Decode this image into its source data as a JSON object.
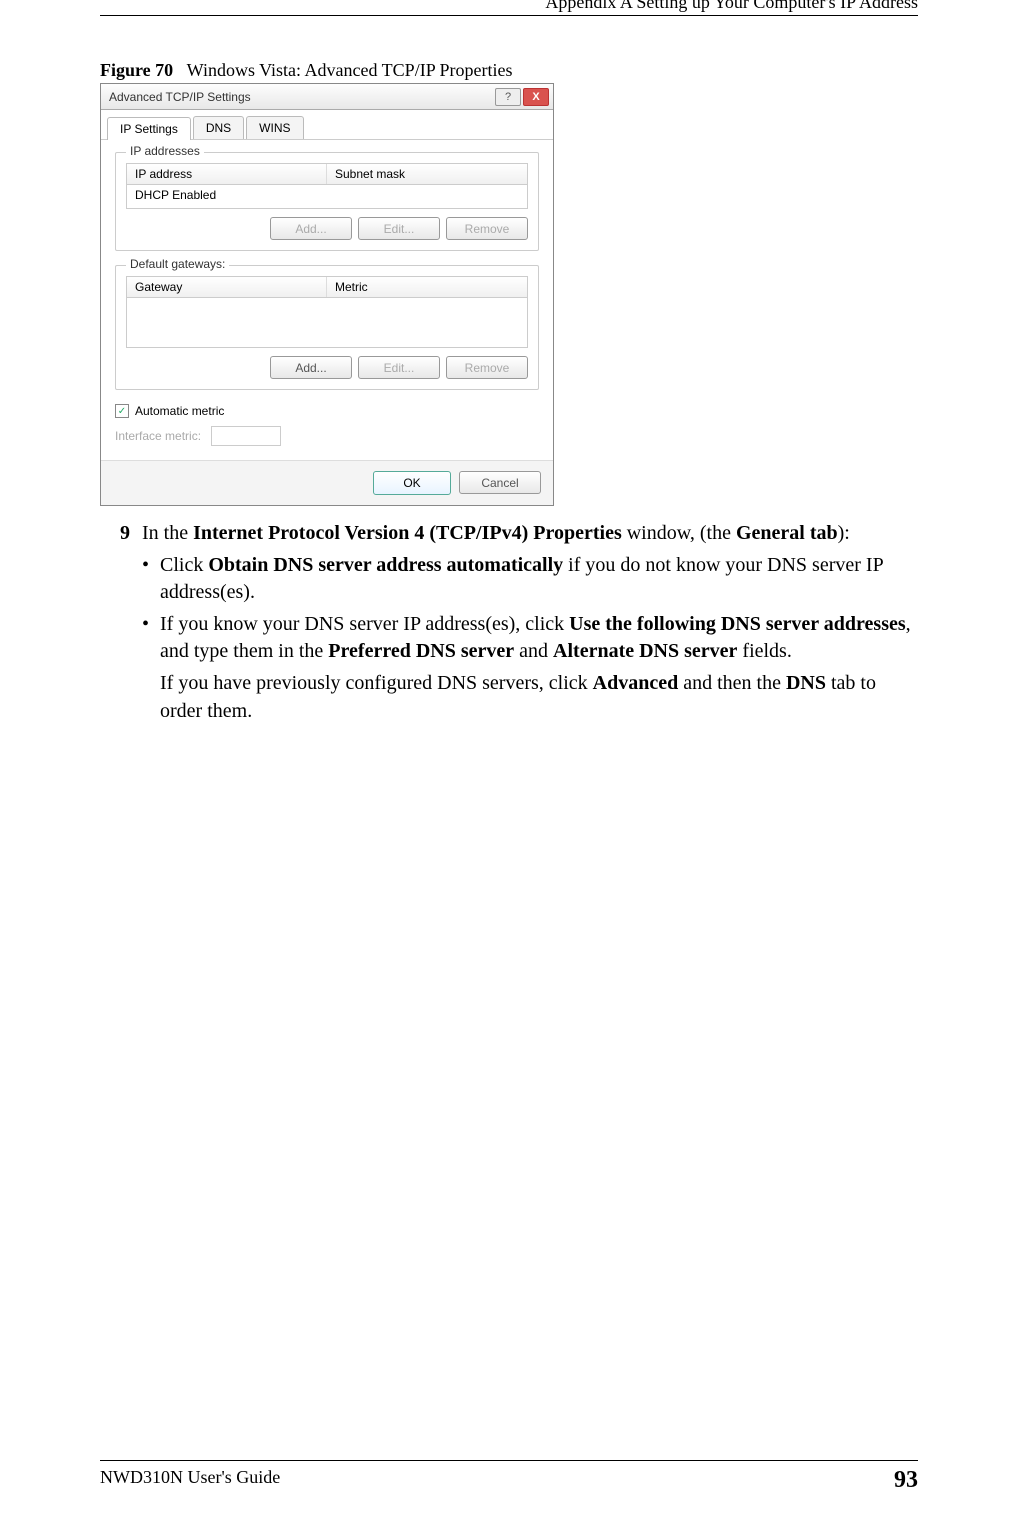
{
  "header": {
    "appendix": "Appendix A Setting up Your Computer's IP Address"
  },
  "figure": {
    "label": "Figure 70",
    "caption": "Windows Vista: Advanced TCP/IP Properties"
  },
  "dialog": {
    "title": "Advanced TCP/IP Settings",
    "help": "?",
    "close": "X",
    "tabs": {
      "ip": "IP Settings",
      "dns": "DNS",
      "wins": "WINS"
    },
    "group_ip": {
      "title": "IP addresses",
      "col_ip": "IP address",
      "col_subnet": "Subnet mask",
      "row_dhcp": "DHCP Enabled",
      "add": "Add...",
      "edit": "Edit...",
      "remove": "Remove"
    },
    "group_gw": {
      "title": "Default gateways:",
      "col_gw": "Gateway",
      "col_metric": "Metric",
      "add": "Add...",
      "edit": "Edit...",
      "remove": "Remove"
    },
    "auto_metric": "Automatic metric",
    "interface_metric": "Interface metric:",
    "ok": "OK",
    "cancel": "Cancel"
  },
  "step": {
    "num": "9",
    "intro_a": "In the ",
    "intro_b": "Internet Protocol Version 4 (TCP/IPv4) Properties",
    "intro_c": " window, (the ",
    "intro_d": "General tab",
    "intro_e": "):",
    "b1_a": "Click ",
    "b1_b": "Obtain DNS server address automatically",
    "b1_c": " if you do not know your DNS server IP address(es).",
    "b2_a": "If you know your DNS server IP address(es), click ",
    "b2_b": "Use the following DNS server addresses",
    "b2_c": ", and type them in the ",
    "b2_d": "Preferred DNS server",
    "b2_e": " and ",
    "b2_f": "Alternate DNS server",
    "b2_g": " fields.",
    "b3_a": "If you have previously configured DNS servers, click ",
    "b3_b": "Advanced",
    "b3_c": " and then the ",
    "b3_d": "DNS",
    "b3_e": " tab to order them."
  },
  "footer": {
    "guide": "NWD310N User's Guide",
    "page": "93"
  }
}
